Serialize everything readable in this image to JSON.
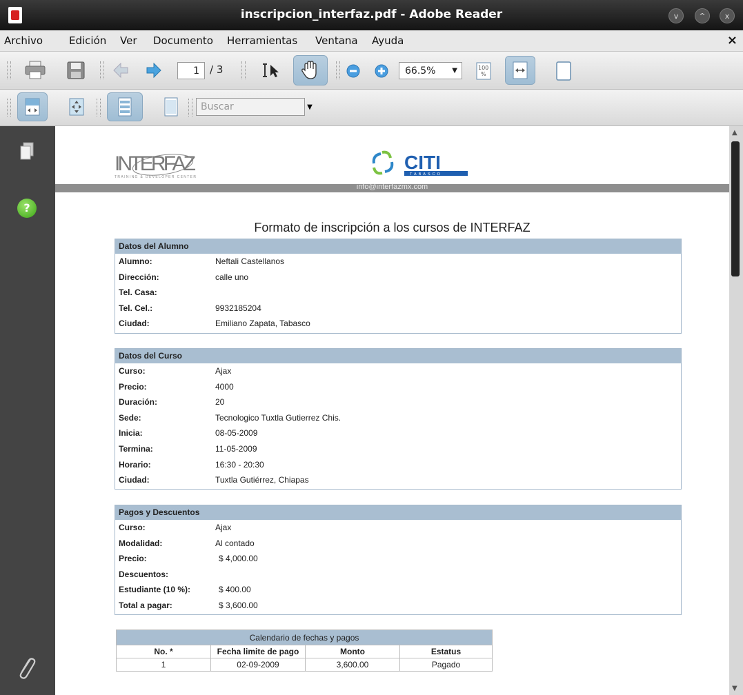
{
  "window": {
    "title": "inscripcion_interfaz.pdf - Adobe Reader",
    "buttons": [
      "v",
      "^",
      "x"
    ]
  },
  "menu": {
    "items": [
      "Archivo",
      "Edición",
      "Ver",
      "Documento",
      "Herramientas",
      "Ventana",
      "Ayuda"
    ],
    "close": "×"
  },
  "toolbar": {
    "page_current": "1",
    "page_total": "/ 3",
    "zoom": "66.5%"
  },
  "toolbar2": {
    "search_placeholder": "Buscar"
  },
  "sidebar": {
    "help": "?"
  },
  "page": {
    "logo_left": "INTERFAZ",
    "logo_left_sub": "TRAINING & DEVELOPER CENTER",
    "logo_right": "CITI",
    "logo_right_sub": "TABASCO",
    "email": "info@interfazmx.com",
    "title": "Formato de inscripción a los cursos de INTERFAZ",
    "alumno": {
      "header": "Datos del Alumno",
      "rows": [
        {
          "label": "Alumno:",
          "value": "Neftali Castellanos"
        },
        {
          "label": "Dirección:",
          "value": "calle uno"
        },
        {
          "label": "Tel. Casa:",
          "value": ""
        },
        {
          "label": "Tel. Cel.:",
          "value": "9932185204"
        },
        {
          "label": "Ciudad:",
          "value": "Emiliano Zapata, Tabasco"
        }
      ]
    },
    "curso": {
      "header": "Datos del Curso",
      "rows": [
        {
          "label": "Curso:",
          "value": "Ajax"
        },
        {
          "label": "Precio:",
          "value": "4000"
        },
        {
          "label": "Duración:",
          "value": "20"
        },
        {
          "label": "Sede:",
          "value": "Tecnologico Tuxtla Gutierrez Chis."
        },
        {
          "label": "Inicia:",
          "value": "08-05-2009"
        },
        {
          "label": "Termina:",
          "value": "11-05-2009"
        },
        {
          "label": "Horario:",
          "value": "16:30 - 20:30"
        },
        {
          "label": "Ciudad:",
          "value": "Tuxtla Gutiérrez, Chiapas"
        }
      ]
    },
    "pagos": {
      "header": "Pagos y Descuentos",
      "rows": [
        {
          "label": "Curso:",
          "value": "Ajax"
        },
        {
          "label": "Modalidad:",
          "value": "Al contado"
        },
        {
          "label": "Precio:",
          "value": "$ 4,000.00"
        },
        {
          "label": "Descuentos:",
          "value": ""
        },
        {
          "label": "Estudiante (10 %):",
          "value": "$ 400.00"
        },
        {
          "label": "Total a pagar:",
          "value": "$ 3,600.00"
        }
      ]
    },
    "calendario": {
      "caption": "Calendario de fechas y pagos",
      "headers": [
        "No. *",
        "Fecha limite de pago",
        "Monto",
        "Estatus"
      ],
      "row": [
        "1",
        "02-09-2009",
        "3,600.00",
        "Pagado"
      ]
    }
  }
}
